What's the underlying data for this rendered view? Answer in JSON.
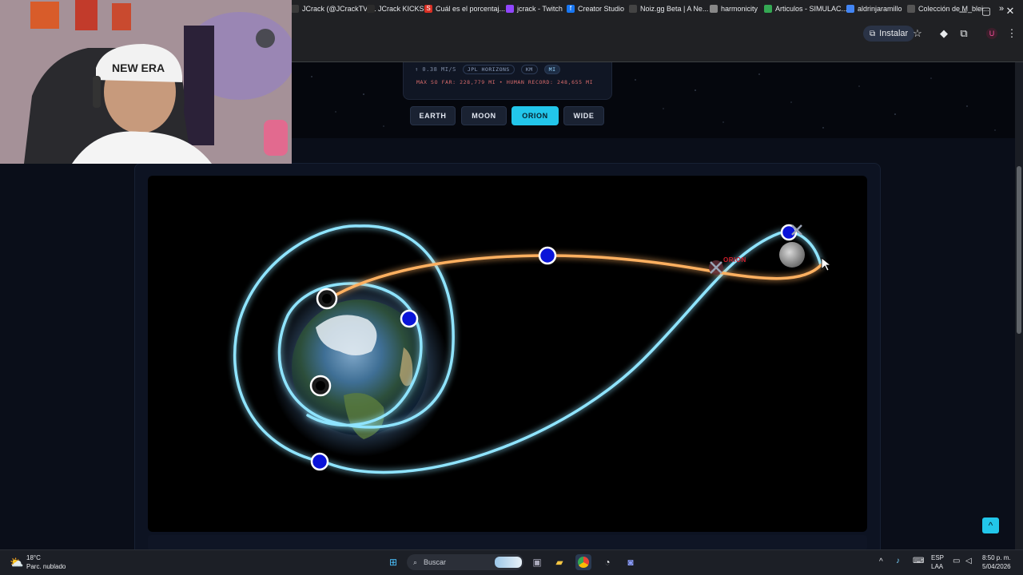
{
  "browser": {
    "install_label": "Instalar",
    "controls": {
      "minimize": "─",
      "maximize": "▢",
      "close": "✕"
    },
    "bookmarks": [
      {
        "label": "JCrack (@JCrackTV)...",
        "color": "#3a3a3a",
        "glyph": ""
      },
      {
        "label": "JCrack KICKS",
        "color": "#2b2b2b",
        "glyph": ""
      },
      {
        "label": "Cuál es el porcentaj...",
        "color": "#d93025",
        "glyph": "S"
      },
      {
        "label": "jcrack - Twitch",
        "color": "#9146ff",
        "glyph": ""
      },
      {
        "label": "Creator Studio",
        "color": "#1877f2",
        "glyph": "f"
      },
      {
        "label": "Noiz.gg Beta | A Ne...",
        "color": "#444",
        "glyph": ""
      },
      {
        "label": "harmonicity",
        "color": "#888",
        "glyph": ""
      },
      {
        "label": "Articulos - SIMULAC...",
        "color": "#34a853",
        "glyph": ""
      },
      {
        "label": "aldrinjaramillo",
        "color": "#4285f4",
        "glyph": ""
      },
      {
        "label": "Colección de M_blei...",
        "color": "#555",
        "glyph": ""
      }
    ],
    "bookmarks_more": "»"
  },
  "stats": {
    "speed": "↑ 0.38 MI/S",
    "source": "JPL HORIZONS",
    "unit_km": "KM",
    "unit_mi": "MI",
    "record_line": "MAX SO FAR: 228,779 MI • HUMAN RECORD: 248,655 MI"
  },
  "views": [
    {
      "label": "EARTH",
      "active": false
    },
    {
      "label": "MOON",
      "active": false
    },
    {
      "label": "ORION",
      "active": true
    },
    {
      "label": "WIDE",
      "active": false
    }
  ],
  "viz": {
    "spacecraft_label": "ORION",
    "colors": {
      "past_path": "#ffb060",
      "future_path": "#8fe4ff",
      "marker": "#0a14d8",
      "accent": "#22c6ea"
    }
  },
  "scroll_top_icon": "^",
  "taskbar": {
    "weather_temp": "18°C",
    "weather_desc": "Parc. nublado",
    "search_placeholder": "Buscar",
    "lang_top": "ESP",
    "lang_bottom": "LAA",
    "time": "8:50 p. m.",
    "date": "5/04/2026"
  }
}
